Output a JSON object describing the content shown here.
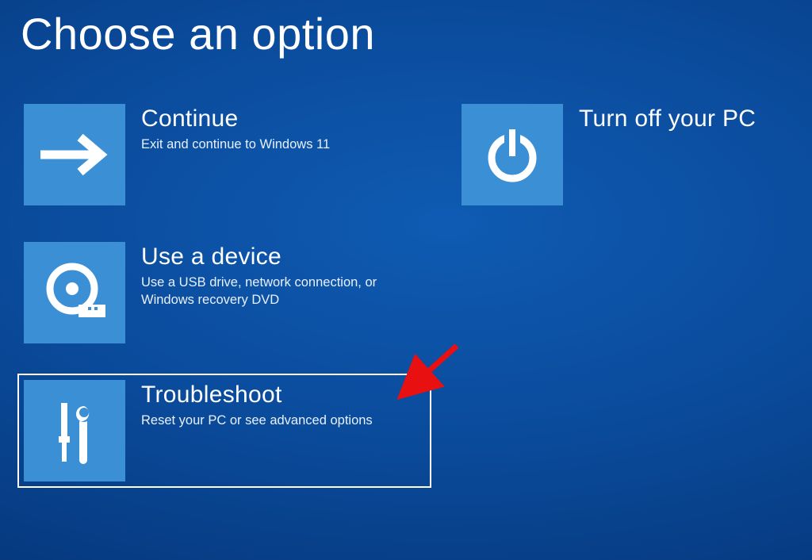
{
  "title": "Choose an option",
  "options": {
    "continue": {
      "title": "Continue",
      "subtitle": "Exit and continue to Windows 11"
    },
    "use_device": {
      "title": "Use a device",
      "subtitle": "Use a USB drive, network connection, or Windows recovery DVD"
    },
    "troubleshoot": {
      "title": "Troubleshoot",
      "subtitle": "Reset your PC or see advanced options"
    },
    "turn_off": {
      "title": "Turn off your PC"
    }
  }
}
